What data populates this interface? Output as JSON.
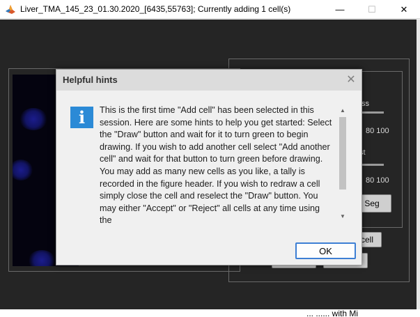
{
  "window": {
    "title": "Liver_TMA_145_23_01.30.2020_[6435,55763]; Currently adding 1 cell(s)",
    "minimize": "—",
    "maximize": "☐",
    "close": "✕"
  },
  "panel": {
    "label_intensity_partial": "ss",
    "label_contrast_partial": "st",
    "ticks_1": "80 100",
    "ticks_2": "80 100",
    "seg_button_partial": "d Seg",
    "cell_button_partial": "cell"
  },
  "dialog": {
    "title": "Helpful hints",
    "close": "✕",
    "icon_glyph": "i",
    "message": "This is the first time \"Add cell\" has been selected in this session. Here are some hints to help you get started: Select the \"Draw\" button and wait for it to turn green to begin drawing. If you wish to add another cell select \"Add another cell\" and wait for that button to turn green before drawing. You may add as many new cells as you like, a tally is recorded in the figure header. If you wish to redraw a cell simply close the cell and reselect the \"Draw\" button. You may either \"Accept\" or \"Reject\" all cells at any time using the",
    "scroll_up": "▲",
    "scroll_down": "▼",
    "ok_label": "OK"
  },
  "bottom_text_partial": "... ...... with Mi",
  "colors": {
    "figure_bg": "#252525",
    "info_icon": "#2b8ad6",
    "ok_border": "#3d7fd4"
  },
  "icons": {
    "app": "matlab-icon",
    "info": "info-icon"
  }
}
